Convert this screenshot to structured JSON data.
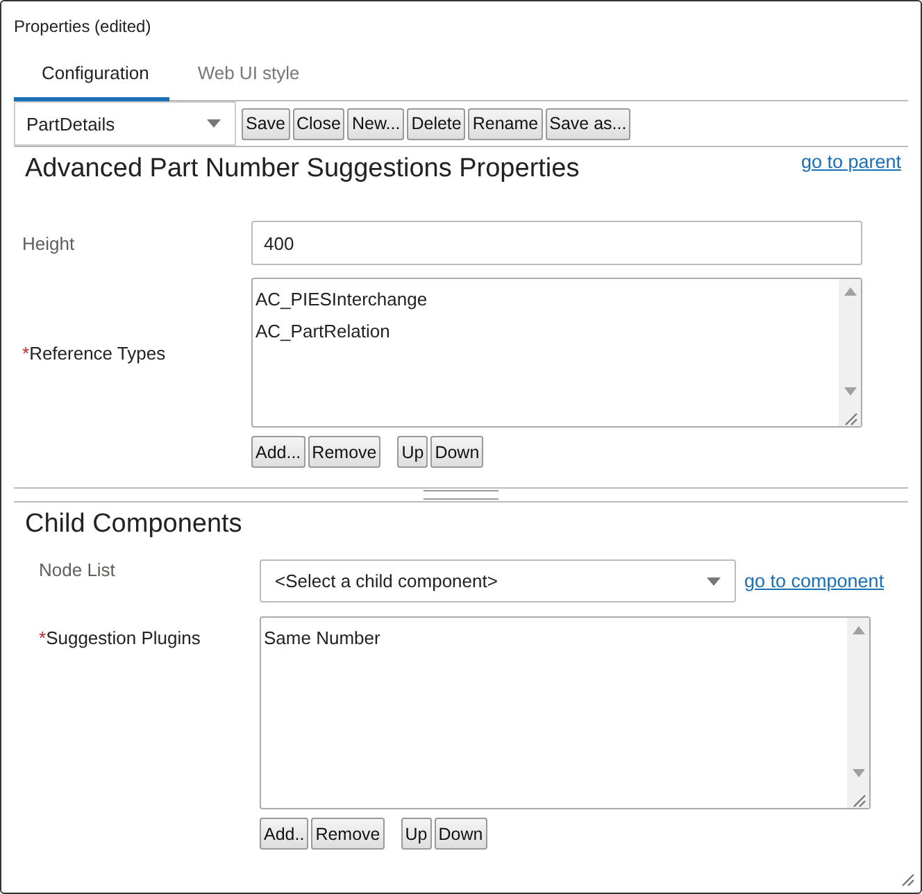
{
  "window": {
    "title": "Properties (edited)"
  },
  "tabs": [
    {
      "label": "Configuration",
      "selected": true
    },
    {
      "label": "Web UI style",
      "selected": false
    }
  ],
  "toolbar": {
    "dropdown": {
      "value": "PartDetails"
    },
    "buttons": [
      "Save",
      "Close",
      "New...",
      "Delete",
      "Rename",
      "Save as..."
    ]
  },
  "sections": [
    {
      "title": "Advanced Part Number Suggestions Properties",
      "link": "go to parent",
      "fields": [
        {
          "kind": "text",
          "label": "Height",
          "value": "400"
        },
        {
          "kind": "list",
          "label": "Reference Types",
          "marker": "*",
          "items": [
            "AC_PIESInterchange",
            "AC_PartRelation"
          ],
          "buttons": [
            [
              "Add...",
              "Remove"
            ],
            [
              "Up",
              "Down"
            ]
          ]
        }
      ]
    },
    {
      "title": "Child Components",
      "fields": [
        {
          "kind": "select",
          "label": "Node List",
          "value": "<Select a child component>",
          "link": "go to component"
        },
        {
          "kind": "list",
          "label": "Suggestion Plugins",
          "marker": "*",
          "items": [
            "Same Number"
          ],
          "buttons": [
            [
              "Add..",
              "Remove"
            ],
            [
              "Up",
              "Down"
            ]
          ]
        }
      ]
    }
  ]
}
